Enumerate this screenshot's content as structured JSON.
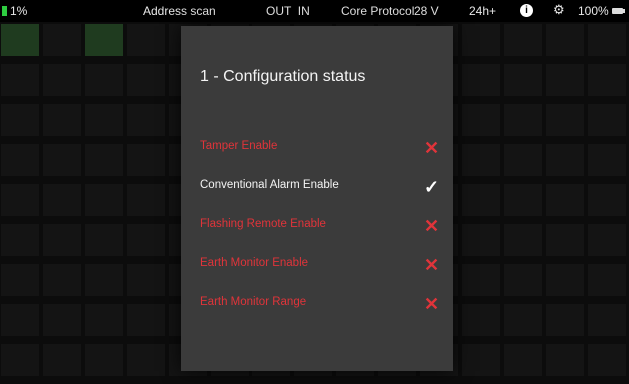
{
  "status_bar": {
    "battery_percent": "1%",
    "mode": "Address scan",
    "io": "OUT  IN",
    "protocol": "Core Protocol",
    "voltage": "28 V",
    "duration": "24h+",
    "info_icon": "info-icon",
    "gear_icon": "gear-icon",
    "battery_right": "100%",
    "battery_icon": "battery-icon",
    "battery_left_color": "#2ecc40"
  },
  "dialog": {
    "title": "1 - Configuration status",
    "items": [
      {
        "label": "Tamper Enable",
        "state": "disabled",
        "icon": "cross-icon"
      },
      {
        "label": "Conventional Alarm Enable",
        "state": "enabled",
        "icon": "check-icon"
      },
      {
        "label": "Flashing Remote Enable",
        "state": "disabled",
        "icon": "cross-icon"
      },
      {
        "label": "Earth Monitor Enable",
        "state": "disabled",
        "icon": "cross-icon"
      },
      {
        "label": "Earth Monitor Range",
        "state": "disabled",
        "icon": "cross-icon"
      }
    ],
    "colors": {
      "disabled": "#e0343a",
      "enabled": "#ffffff",
      "panel": "#3b3b3b"
    }
  }
}
